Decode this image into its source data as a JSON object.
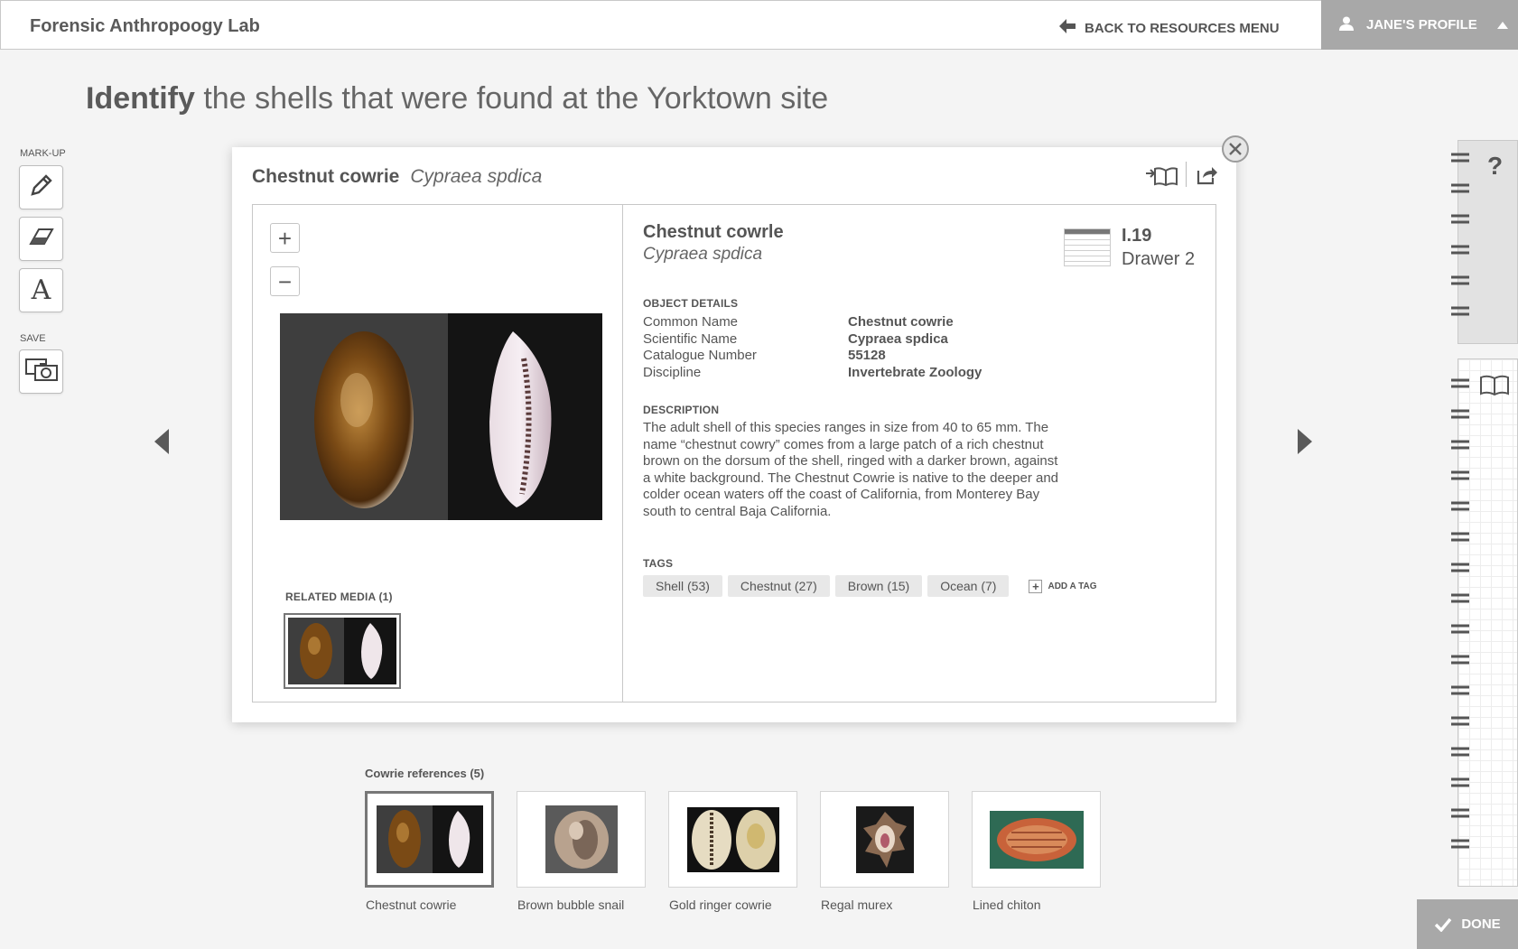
{
  "header": {
    "app_title": "Forensic Anthropoogy Lab",
    "back_label": "BACK TO RESOURCES MENU",
    "profile_label": "JANE'S PROFILE"
  },
  "heading": {
    "bold": "Identify",
    "rest": " the shells that were found at the Yorktown site"
  },
  "tools": {
    "markup_label": "MARK-UP",
    "save_label": "SAVE",
    "text_tool_glyph": "A"
  },
  "modal": {
    "title_common": "Chestnut cowrie",
    "title_scientific": "Cypraea spdica",
    "detail_common": "Chestnut cowrle",
    "detail_scientific": "Cypraea spdica",
    "location_code": "I.19",
    "location_drawer": "Drawer 2",
    "object_details_heading": "OBJECT DETAILS",
    "fields": [
      {
        "label": "Common Name",
        "value": "Chestnut cowrie"
      },
      {
        "label": "Scientific Name",
        "value": "Cypraea spdica"
      },
      {
        "label": "Catalogue Number",
        "value": "55128"
      },
      {
        "label": "Discipline",
        "value": "Invertebrate Zoology"
      }
    ],
    "description_heading": "DESCRIPTION",
    "description_lines": [
      "The adult shell of this species ranges in size from 40 to 65 mm. The",
      "name “chestnut cowry” comes from a large patch of a rich chestnut",
      "brown on the dorsum of the shell, ringed with a darker brown, against",
      "a white background. The Chestnut Cowrie is native to the deeper and",
      "colder ocean waters off the coast of California, from Monterey Bay",
      "south to central Baja California."
    ],
    "tags_heading": "TAGS",
    "tags": [
      "Shell (53)",
      "Chestnut (27)",
      "Brown (15)",
      "Ocean (7)"
    ],
    "add_tag_label": "ADD A TAG",
    "related_media_label": "RELATED MEDIA (1)",
    "zoom_in": "+",
    "zoom_out": "−"
  },
  "references": {
    "title": "Cowrie references (5)",
    "items": [
      {
        "label": "Chestnut cowrie"
      },
      {
        "label": "Brown bubble snail"
      },
      {
        "label": "Gold ringer cowrie"
      },
      {
        "label": "Regal murex"
      },
      {
        "label": "Lined chiton"
      }
    ]
  },
  "side": {
    "help_glyph": "?",
    "done_label": "DONE"
  },
  "icons": {
    "back": "arrow-left-icon",
    "profile": "user-icon",
    "pencil": "pencil-icon",
    "eraser": "eraser-icon",
    "save": "camera-icon",
    "book": "book-icon",
    "share": "share-icon",
    "close": "close-icon",
    "check": "check-icon"
  },
  "colors": {
    "background": "#f4f4f4",
    "profile_bg": "#a8a8a8",
    "text": "#555555"
  }
}
